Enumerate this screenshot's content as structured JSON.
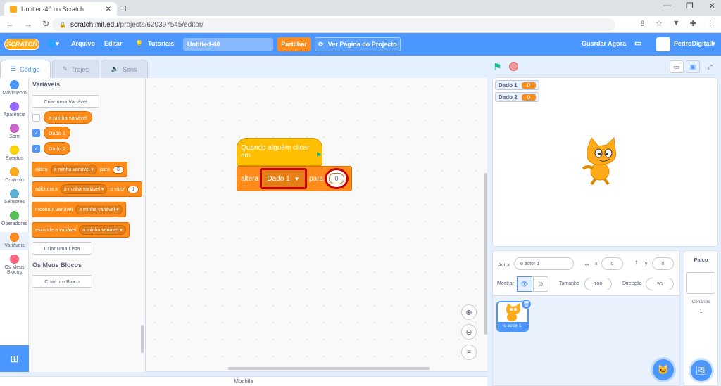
{
  "browser": {
    "tab_title": "Untitled-40 on Scratch",
    "url_host": "scratch.mit.edu",
    "url_path": "/projects/620397545/editor/"
  },
  "menubar": {
    "logo": "SCRATCH",
    "language_icon": "globe-icon",
    "file": "Arquivo",
    "edit": "Editar",
    "tutorials": "Tutoriais",
    "project_title": "Untitled-40",
    "share": "Partilhar",
    "see_project": "Ver Página do Projecto",
    "save_now": "Guardar Agora",
    "username": "PedroDigitalI"
  },
  "editor_tabs": [
    "Código",
    "Trajes",
    "Sons"
  ],
  "categories": [
    {
      "label": "Movimento",
      "color": "#4c97ff"
    },
    {
      "label": "Aparência",
      "color": "#9966ff"
    },
    {
      "label": "Som",
      "color": "#cf63cf"
    },
    {
      "label": "Eventos",
      "color": "#ffd500"
    },
    {
      "label": "Controlo",
      "color": "#ffab19"
    },
    {
      "label": "Sensores",
      "color": "#5cb1d6"
    },
    {
      "label": "Operadores",
      "color": "#59c059"
    },
    {
      "label": "Variáveis",
      "color": "#ff8c1a"
    },
    {
      "label": "Os Meus Blocos",
      "color": "#ff6680"
    }
  ],
  "palette": {
    "section_variables": "Variáveis",
    "make_variable": "Criar uma Variável",
    "variables": [
      {
        "name": "a minha variável",
        "checked": false
      },
      {
        "name": "Dado 1",
        "checked": true
      },
      {
        "name": "Dado 2",
        "checked": true
      }
    ],
    "set_block": {
      "label": "altera",
      "var": "a minha variável",
      "to": "para",
      "value": "0"
    },
    "change_block": {
      "label": "adiciona a",
      "var": "a minha variável",
      "by": "o valor",
      "value": "1"
    },
    "show_block": {
      "label": "mostra a variável",
      "var": "a minha variável"
    },
    "hide_block": {
      "label": "esconde a variável",
      "var": "a minha variável"
    },
    "make_list": "Criar uma Lista",
    "section_my_blocks": "Os Meus Blocos",
    "make_block": "Criar um Bloco"
  },
  "script": {
    "hat": "Quando alguém clicar em",
    "set_label": "altera",
    "set_var": "Dado 1",
    "set_to": "para",
    "set_value": "0"
  },
  "backpack": "Mochila",
  "stage_monitors": [
    {
      "name": "Dado 1",
      "value": "0"
    },
    {
      "name": "Dado 2",
      "value": "0"
    }
  ],
  "sprite_info": {
    "sprite_label": "Actor",
    "sprite_name": "o actor 1",
    "x_label": "x",
    "x_value": "0",
    "y_label": "y",
    "y_value": "0",
    "show_label": "Mostrar",
    "size_label": "Tamanho",
    "size_value": "100",
    "direction_label": "Direcção",
    "direction_value": "90"
  },
  "sprites": [
    {
      "name": "o actor 1"
    }
  ],
  "stage_pane": {
    "title": "Palco",
    "backdrops_label": "Cenários",
    "backdrops_count": "1"
  }
}
